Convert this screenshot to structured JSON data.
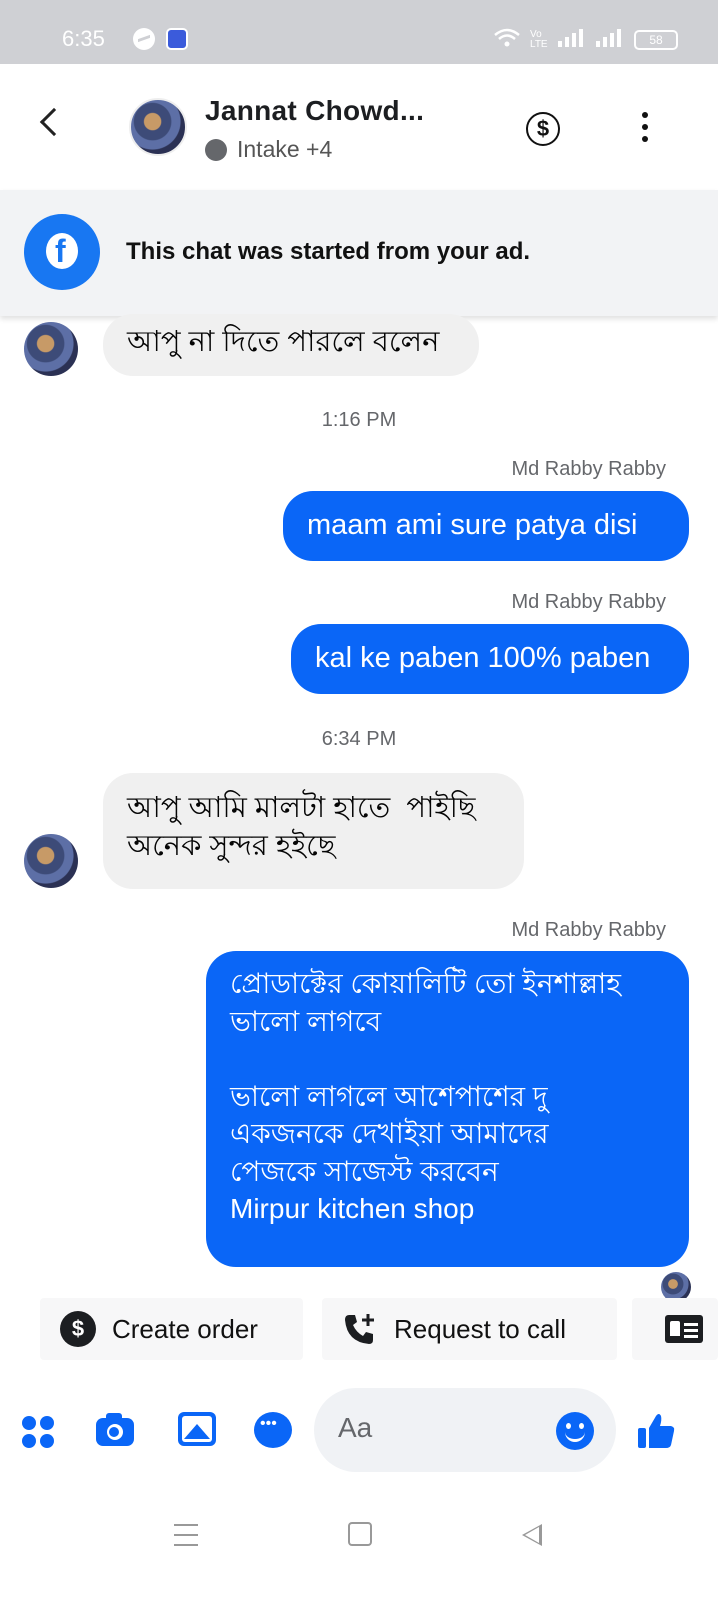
{
  "status_bar": {
    "time": "6:35",
    "network_label": "Vo LTE",
    "battery": "58",
    "icons": [
      "messenger-icon",
      "app-icon",
      "wifi-icon",
      "signal-icon",
      "signal-icon",
      "battery-icon"
    ]
  },
  "header": {
    "contact_name": "Jannat Chowd...",
    "subtitle": "Intake +4",
    "icons": [
      "back-icon",
      "dollar-icon",
      "more-icon"
    ]
  },
  "ad_banner": {
    "text": "This chat was started from your ad."
  },
  "messages": [
    {
      "type": "incoming",
      "text": "আপু না দিতে পারলে বলেন"
    },
    {
      "type": "timestamp",
      "text": "1:16 PM"
    },
    {
      "type": "sender",
      "text": "Md Rabby Rabby"
    },
    {
      "type": "outgoing",
      "text": "maam ami sure patya disi"
    },
    {
      "type": "sender",
      "text": "Md Rabby Rabby"
    },
    {
      "type": "outgoing",
      "text": "kal ke paben 100% paben"
    },
    {
      "type": "timestamp",
      "text": "6:34 PM"
    },
    {
      "type": "incoming",
      "text": "আপু আমি মালটা হাতে  পাইছি\nঅনেক সুন্দর হইছে"
    },
    {
      "type": "sender",
      "text": "Md Rabby Rabby"
    },
    {
      "type": "outgoing",
      "text": "প্রোডাক্টের কোয়ালিটি তো ইনশাল্লাহ\nভালো লাগবে\n\nভালো লাগলে আশেপাশের দু\nএকজনকে দেখাইয়া আমাদের\nপেজকে সাজেস্ট করবেন\nMirpur kitchen shop"
    }
  ],
  "quick_actions": [
    {
      "label": "Create order",
      "icon": "dollar-icon"
    },
    {
      "label": "Request to call",
      "icon": "phone-add-icon"
    },
    {
      "label": "",
      "icon": "contact-card-icon"
    }
  ],
  "composer": {
    "placeholder": "Aa",
    "icons": [
      "apps-icon",
      "camera-icon",
      "gallery-icon",
      "chat-icon",
      "emoji-icon",
      "like-icon"
    ]
  },
  "colors": {
    "accent": "#0a66f7",
    "facebook": "#1877f2",
    "incoming_bubble": "#f0f0f0",
    "status_bar": "#cfd0d4"
  }
}
